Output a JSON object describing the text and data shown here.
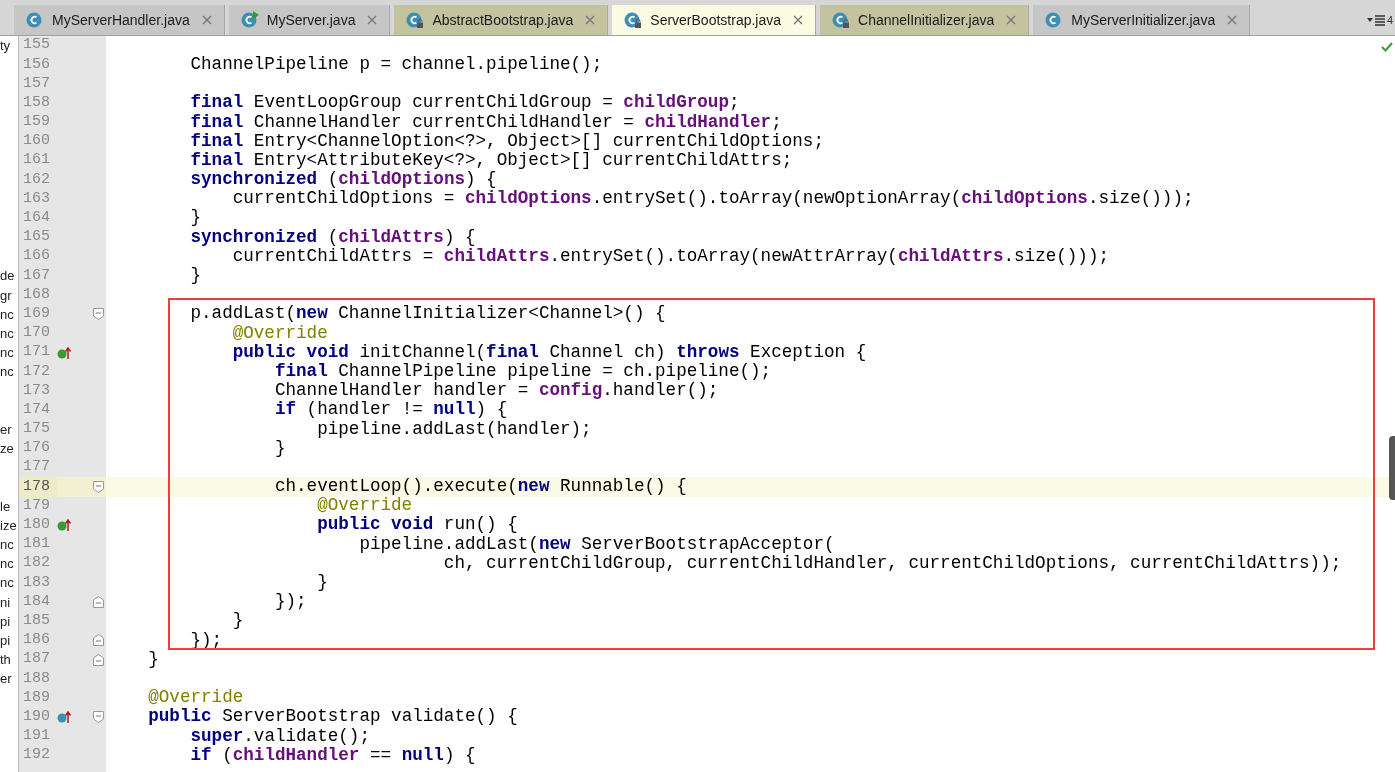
{
  "tabs": [
    {
      "label": "MyServerHandler.java",
      "selected": false,
      "readonly": false,
      "runnable": false
    },
    {
      "label": "MyServer.java",
      "selected": false,
      "readonly": false,
      "runnable": true
    },
    {
      "label": "AbstractBootstrap.java",
      "selected": false,
      "readonly": true,
      "runnable": false
    },
    {
      "label": "ServerBootstrap.java",
      "selected": true,
      "readonly": true,
      "runnable": false
    },
    {
      "label": "ChannelInitializer.java",
      "selected": false,
      "readonly": true,
      "runnable": false
    },
    {
      "label": "MyServerInitializer.java",
      "selected": false,
      "readonly": false,
      "runnable": false
    }
  ],
  "tab_overflow_count": "4",
  "code_before": [
    {
      "n": "155",
      "side": "ty",
      "current": false
    },
    {
      "n": "156",
      "current": false,
      "tokens": [
        {
          "kind": "plain",
          "text": "        ChannelPipeline p = channel.pipeline();"
        }
      ]
    },
    {
      "n": "157",
      "current": false
    },
    {
      "n": "158",
      "current": false,
      "tokens": [
        {
          "kind": "keyword",
          "text": "        final"
        },
        {
          "kind": "plain",
          "text": " EventLoopGroup currentChildGroup = "
        },
        {
          "kind": "field",
          "text": "childGroup"
        },
        {
          "kind": "plain",
          "text": ";"
        }
      ]
    },
    {
      "n": "159",
      "current": false,
      "tokens": [
        {
          "kind": "keyword",
          "text": "        final"
        },
        {
          "kind": "plain",
          "text": " ChannelHandler currentChildHandler = "
        },
        {
          "kind": "field",
          "text": "childHandler"
        },
        {
          "kind": "plain",
          "text": ";"
        }
      ]
    },
    {
      "n": "160",
      "current": false,
      "tokens": [
        {
          "kind": "keyword",
          "text": "        final"
        },
        {
          "kind": "plain",
          "text": " Entry<ChannelOption<?>, Object>[] currentChildOptions;"
        }
      ]
    },
    {
      "n": "161",
      "current": false,
      "tokens": [
        {
          "kind": "keyword",
          "text": "        final"
        },
        {
          "kind": "plain",
          "text": " Entry<AttributeKey<?>, Object>[] currentChildAttrs;"
        }
      ]
    },
    {
      "n": "162",
      "current": false,
      "tokens": [
        {
          "kind": "keyword",
          "text": "        synchronized"
        },
        {
          "kind": "plain",
          "text": " ("
        },
        {
          "kind": "field",
          "text": "childOptions"
        },
        {
          "kind": "plain",
          "text": ") {"
        }
      ]
    },
    {
      "n": "163",
      "current": false,
      "tokens": [
        {
          "kind": "plain",
          "text": "            currentChildOptions = "
        },
        {
          "kind": "field",
          "text": "childOptions"
        },
        {
          "kind": "plain",
          "text": ".entrySet().toArray(newOptionArray("
        },
        {
          "kind": "field",
          "text": "childOptions"
        },
        {
          "kind": "plain",
          "text": ".size()));"
        }
      ]
    },
    {
      "n": "164",
      "current": false,
      "tokens": [
        {
          "kind": "plain",
          "text": "        }"
        }
      ]
    },
    {
      "n": "165",
      "current": false,
      "tokens": [
        {
          "kind": "keyword",
          "text": "        synchronized"
        },
        {
          "kind": "plain",
          "text": " ("
        },
        {
          "kind": "field",
          "text": "childAttrs"
        },
        {
          "kind": "plain",
          "text": ") {"
        }
      ]
    },
    {
      "n": "166",
      "current": false,
      "tokens": [
        {
          "kind": "plain",
          "text": "            currentChildAttrs = "
        },
        {
          "kind": "field",
          "text": "childAttrs"
        },
        {
          "kind": "plain",
          "text": ".entrySet().toArray(newAttrArray("
        },
        {
          "kind": "field",
          "text": "childAttrs"
        },
        {
          "kind": "plain",
          "text": ".size()));"
        }
      ]
    },
    {
      "n": "167",
      "side": "de",
      "current": false,
      "tokens": [
        {
          "kind": "plain",
          "text": "        }"
        }
      ]
    },
    {
      "n": "168",
      "side": "gr",
      "current": false
    }
  ],
  "highlighted_code": [
    {
      "n": "169",
      "side": "nc",
      "gutter": [
        {
          "kind": "fold_start"
        }
      ],
      "current": false,
      "tokens": [
        {
          "kind": "plain",
          "text": "        p.addLast("
        },
        {
          "kind": "keyword",
          "text": "new"
        },
        {
          "kind": "plain",
          "text": " ChannelInitializer<Channel>() {"
        }
      ]
    },
    {
      "n": "170",
      "side": "nc",
      "current": false,
      "tokens": [
        {
          "kind": "annotation",
          "text": "            @Override"
        }
      ]
    },
    {
      "n": "171",
      "side": "nc",
      "gutter": [
        {
          "kind": "override"
        }
      ],
      "current": false,
      "tokens": [
        {
          "kind": "keyword",
          "text": "            public void"
        },
        {
          "kind": "plain",
          "text": " initChannel("
        },
        {
          "kind": "keyword",
          "text": "final"
        },
        {
          "kind": "plain",
          "text": " Channel ch) "
        },
        {
          "kind": "keyword",
          "text": "throws"
        },
        {
          "kind": "plain",
          "text": " Exception {"
        }
      ]
    },
    {
      "n": "172",
      "side": "nc",
      "current": false,
      "tokens": [
        {
          "kind": "keyword",
          "text": "                final"
        },
        {
          "kind": "plain",
          "text": " ChannelPipeline pipeline = ch.pipeline();"
        }
      ]
    },
    {
      "n": "173",
      "current": false,
      "tokens": [
        {
          "kind": "plain",
          "text": "                ChannelHandler handler = "
        },
        {
          "kind": "field",
          "text": "config"
        },
        {
          "kind": "plain",
          "text": ".handler();"
        }
      ]
    },
    {
      "n": "174",
      "current": false,
      "tokens": [
        {
          "kind": "keyword",
          "text": "                if"
        },
        {
          "kind": "plain",
          "text": " (handler != "
        },
        {
          "kind": "keyword",
          "text": "null"
        },
        {
          "kind": "plain",
          "text": ") {"
        }
      ]
    },
    {
      "n": "175",
      "side": "er",
      "current": false,
      "tokens": [
        {
          "kind": "plain",
          "text": "                    pipeline.addLast(handler);"
        }
      ]
    },
    {
      "n": "176",
      "side": "ze",
      "current": false,
      "tokens": [
        {
          "kind": "plain",
          "text": "                }"
        }
      ]
    },
    {
      "n": "177",
      "current": false
    },
    {
      "n": "178",
      "gutter": [
        {
          "kind": "fold_start"
        }
      ],
      "current": true,
      "tokens": [
        {
          "kind": "plain",
          "text": "                ch.eventLoop().execute("
        },
        {
          "kind": "keyword",
          "text": "new"
        },
        {
          "kind": "plain",
          "text": " Runnable() {"
        }
      ]
    },
    {
      "n": "179",
      "side": "le",
      "current": false,
      "tokens": [
        {
          "kind": "annotation",
          "text": "                    @Override"
        }
      ]
    },
    {
      "n": "180",
      "side": "ize",
      "gutter": [
        {
          "kind": "override"
        }
      ],
      "current": false,
      "tokens": [
        {
          "kind": "keyword",
          "text": "                    public void"
        },
        {
          "kind": "plain",
          "text": " run() {"
        }
      ]
    },
    {
      "n": "181",
      "side": "nc",
      "current": false,
      "tokens": [
        {
          "kind": "plain",
          "text": "                        pipeline.addLast("
        },
        {
          "kind": "keyword",
          "text": "new"
        },
        {
          "kind": "plain",
          "text": " ServerBootstrapAcceptor("
        }
      ]
    },
    {
      "n": "182",
      "side": "nc",
      "current": false,
      "tokens": [
        {
          "kind": "plain",
          "text": "                                ch, currentChildGroup, currentChildHandler, currentChildOptions, currentChildAttrs));"
        }
      ]
    },
    {
      "n": "183",
      "side": "nc",
      "current": false,
      "tokens": [
        {
          "kind": "plain",
          "text": "                    }"
        }
      ]
    },
    {
      "n": "184",
      "side": "ni",
      "gutter": [
        {
          "kind": "fold_end"
        }
      ],
      "current": false,
      "tokens": [
        {
          "kind": "plain",
          "text": "                });"
        }
      ]
    },
    {
      "n": "185",
      "side": "pi",
      "current": false,
      "tokens": [
        {
          "kind": "plain",
          "text": "            }"
        }
      ]
    },
    {
      "n": "186",
      "side": "pi",
      "gutter": [
        {
          "kind": "fold_end"
        }
      ],
      "current": false,
      "tokens": [
        {
          "kind": "plain",
          "text": "        });"
        }
      ]
    }
  ],
  "code_after": [
    {
      "n": "187",
      "side": "th",
      "gutter": [
        {
          "kind": "fold_end"
        }
      ],
      "current": false,
      "tokens": [
        {
          "kind": "plain",
          "text": "    }"
        }
      ]
    },
    {
      "n": "188",
      "side": "er",
      "current": false
    },
    {
      "n": "189",
      "current": false,
      "tokens": [
        {
          "kind": "annotation",
          "text": "    @Override"
        }
      ]
    },
    {
      "n": "190",
      "gutter": [
        {
          "kind": "implements"
        },
        {
          "kind": "fold_start"
        }
      ],
      "current": false,
      "tokens": [
        {
          "kind": "keyword",
          "text": "    public"
        },
        {
          "kind": "plain",
          "text": " ServerBootstrap validate() {"
        }
      ]
    },
    {
      "n": "191",
      "current": false,
      "tokens": [
        {
          "kind": "keyword",
          "text": "        super"
        },
        {
          "kind": "plain",
          "text": ".validate();"
        }
      ]
    },
    {
      "n": "192",
      "current": false,
      "tokens": [
        {
          "kind": "keyword",
          "text": "        if"
        },
        {
          "kind": "plain",
          "text": " ("
        },
        {
          "kind": "field",
          "text": "childHandler"
        },
        {
          "kind": "plain",
          "text": " == "
        },
        {
          "kind": "keyword",
          "text": "null"
        },
        {
          "kind": "plain",
          "text": ") {"
        }
      ]
    }
  ]
}
